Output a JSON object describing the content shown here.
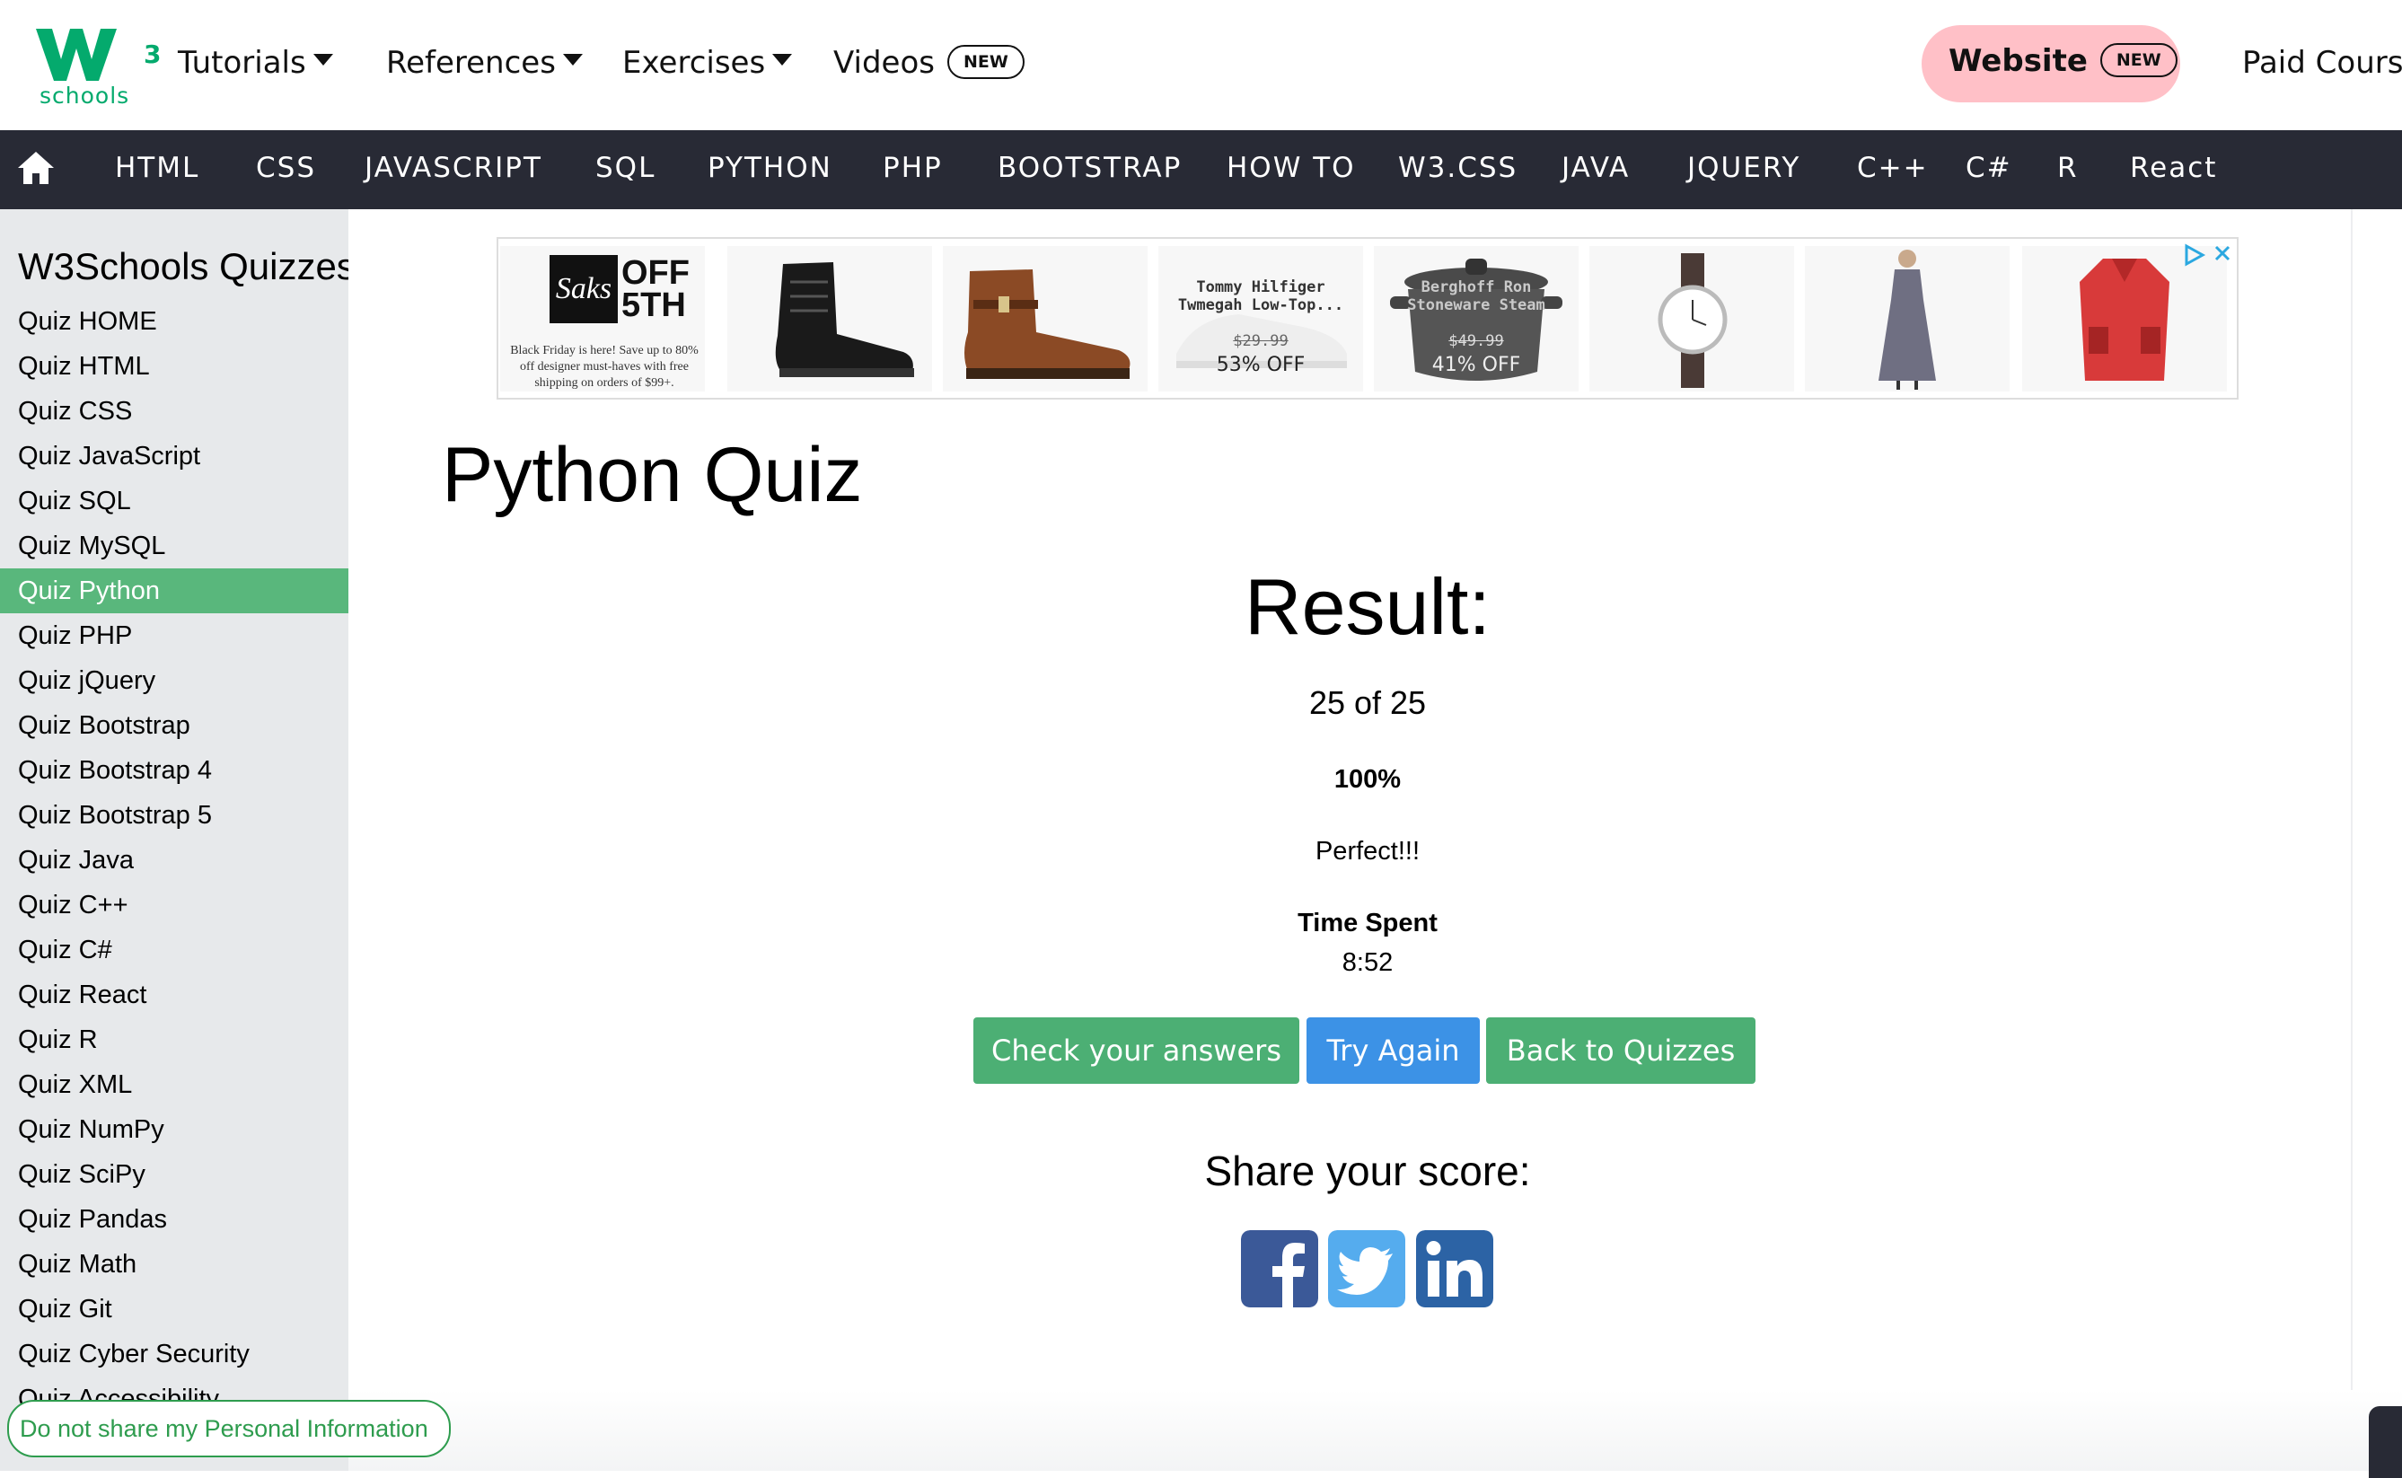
{
  "logo": {
    "superscript": "3",
    "text": "schools"
  },
  "topnav": {
    "tutorials": "Tutorials",
    "references": "References",
    "exercises": "Exercises",
    "videos": "Videos",
    "videos_badge": "NEW",
    "website": "Website",
    "website_badge": "NEW",
    "paid_courses": "Paid Courses"
  },
  "subjects": [
    "HTML",
    "CSS",
    "JAVASCRIPT",
    "SQL",
    "PYTHON",
    "PHP",
    "BOOTSTRAP",
    "HOW TO",
    "W3.CSS",
    "JAVA",
    "JQUERY",
    "C++",
    "C#",
    "R",
    "React"
  ],
  "sidebar": {
    "title": "W3Schools Quizzes",
    "items": [
      "Quiz HOME",
      "Quiz HTML",
      "Quiz CSS",
      "Quiz JavaScript",
      "Quiz SQL",
      "Quiz MySQL",
      "Quiz Python",
      "Quiz PHP",
      "Quiz jQuery",
      "Quiz Bootstrap",
      "Quiz Bootstrap 4",
      "Quiz Bootstrap 5",
      "Quiz Java",
      "Quiz C++",
      "Quiz C#",
      "Quiz React",
      "Quiz R",
      "Quiz XML",
      "Quiz NumPy",
      "Quiz SciPy",
      "Quiz Pandas",
      "Quiz Math",
      "Quiz Git",
      "Quiz Cyber Security",
      "Quiz Accessibility"
    ],
    "active_item": "Quiz Python"
  },
  "ad": {
    "saks_logo": "Saks",
    "saks_off_line1": "OFF",
    "saks_off_line2": "5TH",
    "saks_fine_print": "Black Friday is here! Save up to 80% off designer must-haves with free shipping on orders of $99+.",
    "tile4_title_1": "Tommy Hilfiger",
    "tile4_title_2": "Twmegah Low-Top...",
    "tile4_price": "$29.99",
    "tile4_discount": "53% OFF",
    "tile5_title_1": "Berghoff Ron",
    "tile5_title_2": "Stoneware Steam",
    "tile5_price": "$49.99",
    "tile5_discount": "41% OFF"
  },
  "main": {
    "page_title": "Python Quiz",
    "result_heading": "Result:",
    "score": "25 of 25",
    "percent": "100%",
    "message": "Perfect!!!",
    "time_spent_label": "Time Spent",
    "time_spent_value": "8:52",
    "buttons": {
      "check": "Check your answers",
      "try_again": "Try Again",
      "back": "Back to Quizzes"
    },
    "share_heading": "Share your score:"
  },
  "privacy_button": "Do not share my Personal Information",
  "colors": {
    "brand_green": "#04AA6D",
    "subject_bar": "#282A35",
    "sidebar_bg": "#E7E9EB",
    "sidebar_active": "#59B77C",
    "button_green": "#4CAF74",
    "button_blue": "#3C92E6",
    "website_pill": "#FFC0C7",
    "facebook": "#3B5998",
    "twitter": "#55ACEE",
    "linkedin": "#2C63A5"
  },
  "icons": {
    "home": "home-icon",
    "share": [
      "facebook-icon",
      "twitter-icon",
      "linkedin-icon"
    ],
    "ad_choices": "adchoices-icon",
    "ad_close": "close-icon"
  }
}
